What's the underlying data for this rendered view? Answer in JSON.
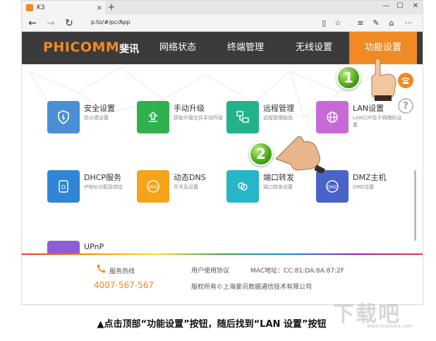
{
  "browser": {
    "tab_title": "K3",
    "tab_close": "×",
    "new_tab": "+",
    "url": "p.to/#/pc/App",
    "win_min": "—",
    "win_max": "☐",
    "win_close": "✕"
  },
  "site": {
    "logo": "PHICOMM",
    "logo_cn": "斐讯",
    "nav": [
      {
        "label": "网络状态",
        "active": false
      },
      {
        "label": "终端管理",
        "active": false
      },
      {
        "label": "无线设置",
        "active": false
      },
      {
        "label": "功能设置",
        "active": true
      }
    ]
  },
  "cards": [
    {
      "title": "安全设置",
      "desc": "防火墙设置",
      "color": "#4a8fd6",
      "icon": "shield-icon"
    },
    {
      "title": "手动升级",
      "desc": "获取升级文件手动升级",
      "color": "#2fb14e",
      "icon": "upload-icon"
    },
    {
      "title": "远程管理",
      "desc": "远程管理路由",
      "color": "#23b28c",
      "icon": "remote-icon"
    },
    {
      "title": "LAN设置",
      "desc": "LAN口IP及子网掩码设置",
      "color": "#c76ad6",
      "icon": "globe-icon"
    },
    {
      "title": "DHCP服务",
      "desc": "IP地址分配及绑定",
      "color": "#2f86d6",
      "icon": "dhcp-icon"
    },
    {
      "title": "动态DNS",
      "desc": "开关及设置",
      "color": "#f5a319",
      "icon": "dns-icon"
    },
    {
      "title": "端口转发",
      "desc": "端口转发设置",
      "color": "#27b5c8",
      "icon": "port-icon"
    },
    {
      "title": "DMZ主机",
      "desc": "DMZ设置",
      "color": "#4a63c8",
      "icon": "dmz-icon"
    },
    {
      "title": "UPnP",
      "desc": "",
      "color": "#8e5dd1",
      "icon": "upnp-icon"
    }
  ],
  "overlay": {
    "step1": "1",
    "step2": "2"
  },
  "footer": {
    "hotline_label": "服务热线",
    "hotline_number": "4007-567-567",
    "agreement": "用户使用协议",
    "mac": "MAC地址：CC:81:DA:8A:87:2F",
    "copyright": "版权所有©上海斐讯数据通信技术有限公司"
  },
  "caption": "▲点击顶部“功能设置”按钮，随后找到“LAN 设置”按钮",
  "watermark": "下载吧",
  "watermark_sub": "www.xiazaiba.com",
  "colors": {
    "accent": "#f08a24",
    "nav_bg": "#3b3b3b"
  }
}
